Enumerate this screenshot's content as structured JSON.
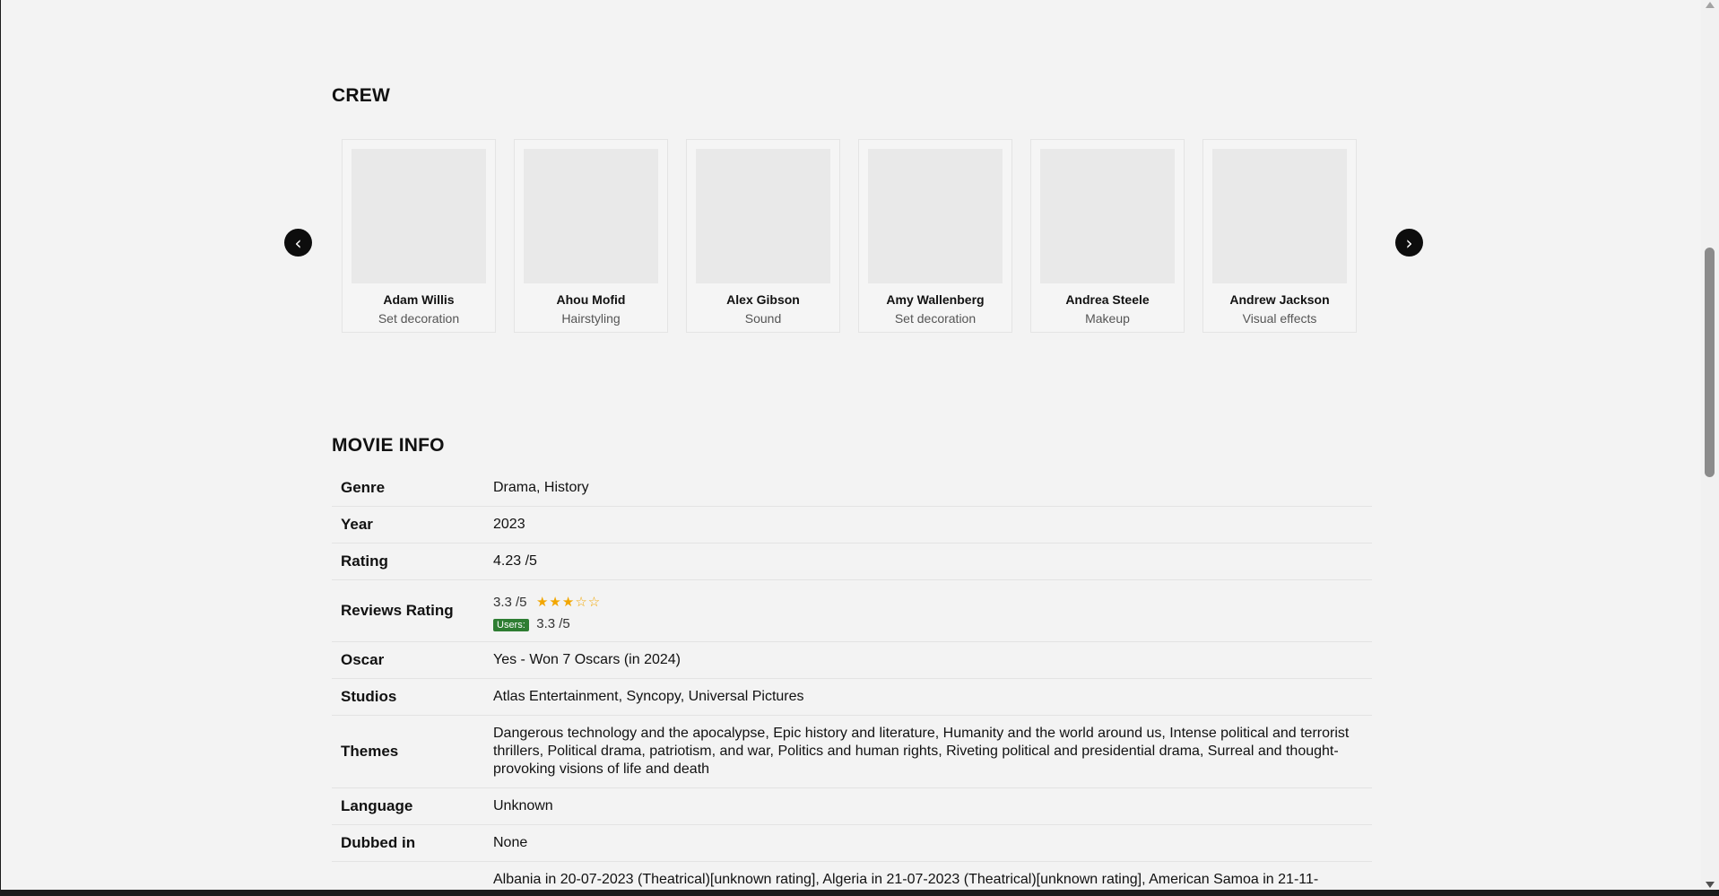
{
  "crew": {
    "title": "CREW",
    "prev_label": "‹",
    "next_label": "›",
    "members": [
      {
        "name": "Adam Willis",
        "role": "Set decoration"
      },
      {
        "name": "Ahou Mofid",
        "role": "Hairstyling"
      },
      {
        "name": "Alex Gibson",
        "role": "Sound"
      },
      {
        "name": "Amy Wallenberg",
        "role": "Set decoration"
      },
      {
        "name": "Andrea Steele",
        "role": "Makeup"
      },
      {
        "name": "Andrew Jackson",
        "role": "Visual effects"
      }
    ]
  },
  "movie_info": {
    "title": "MOVIE INFO",
    "rows": {
      "genre": {
        "key": "Genre",
        "value": "Drama, History"
      },
      "year": {
        "key": "Year",
        "value": "2023"
      },
      "rating": {
        "key": "Rating",
        "value": "4.23 /5"
      },
      "reviews_rating": {
        "key": "Reviews Rating",
        "critics": "3.3 /5",
        "stars": "★★★☆☆",
        "stars_value": 3,
        "users_label": "Users:",
        "users": "3.3 /5"
      },
      "oscar": {
        "key": "Oscar",
        "value": "Yes - Won 7 Oscars (in 2024)"
      },
      "studios": {
        "key": "Studios",
        "value": "Atlas Entertainment, Syncopy, Universal Pictures"
      },
      "themes": {
        "key": "Themes",
        "value": "Dangerous technology and the apocalypse, Epic history and literature, Humanity and the world around us, Intense political and terrorist thrillers, Political drama, patriotism, and war, Politics and human rights, Riveting political and presidential drama, Surreal and thought-provoking visions of life and death"
      },
      "language": {
        "key": "Language",
        "value": "Unknown"
      },
      "dubbed": {
        "key": "Dubbed in",
        "value": "None"
      },
      "releases": {
        "key": "",
        "value": "Albania in 20-07-2023 (Theatrical)[unknown rating], Algeria in 21-07-2023 (Theatrical)[unknown rating], American Samoa in 21-11-"
      }
    }
  },
  "colors": {
    "background": "#f3f3f3",
    "star": "#f2a600",
    "users_badge": "#2e7d32",
    "nav_button": "#0d0d0d"
  }
}
